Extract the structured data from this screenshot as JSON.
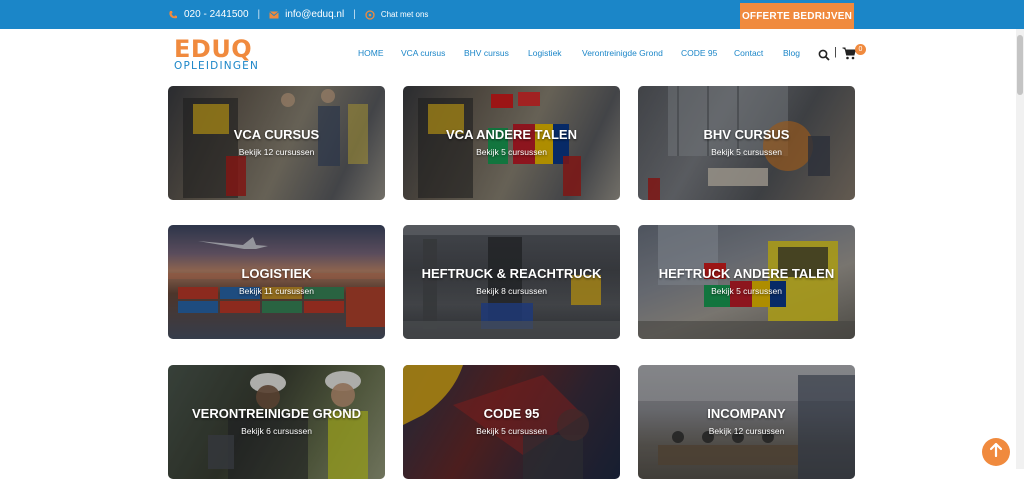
{
  "topbar": {
    "phone": "020 - 2441500",
    "email": "info@eduq.nl",
    "chat": "Chat met ons",
    "separator": "|",
    "offerte_label": "OFFERTE BEDRIJVEN",
    "icons": [
      "phone-icon",
      "mail-icon",
      "chat-icon"
    ]
  },
  "logo": {
    "line1": "EDUQ",
    "line2": "OPLEIDINGEN"
  },
  "nav": {
    "items": [
      {
        "label": "HOME"
      },
      {
        "label": "VCA cursus"
      },
      {
        "label": "BHV cursus"
      },
      {
        "label": "Logistiek"
      },
      {
        "label": "Verontreinigde Grond"
      },
      {
        "label": "CODE 95"
      },
      {
        "label": "Contact"
      },
      {
        "label": "Blog"
      }
    ],
    "separator": "|",
    "cart_count": "0",
    "icons": [
      "search-icon",
      "cart-icon"
    ]
  },
  "cards": [
    {
      "title": "VCA CURSUS",
      "subtitle": "Bekijk 12 cursussen"
    },
    {
      "title": "VCA ANDERE TALEN",
      "subtitle": "Bekijk 5 cursussen"
    },
    {
      "title": "BHV CURSUS",
      "subtitle": "Bekijk 5 cursussen"
    },
    {
      "title": "LOGISTIEK",
      "subtitle": "Bekijk 11 cursussen"
    },
    {
      "title": "HEFTRUCK & REACHTRUCK",
      "subtitle": "Bekijk 8 cursussen"
    },
    {
      "title": "HEFTRUCK ANDERE TALEN",
      "subtitle": "Bekijk 5 cursussen"
    },
    {
      "title": "VERONTREINIGDE GROND",
      "subtitle": "Bekijk 6 cursussen"
    },
    {
      "title": "CODE 95",
      "subtitle": "Bekijk 5 cursussen"
    },
    {
      "title": "INCOMPANY",
      "subtitle": "Bekijk 12 cursussen"
    }
  ],
  "colors": {
    "brand_blue": "#1b86c8",
    "accent_orange": "#f08a3e"
  }
}
